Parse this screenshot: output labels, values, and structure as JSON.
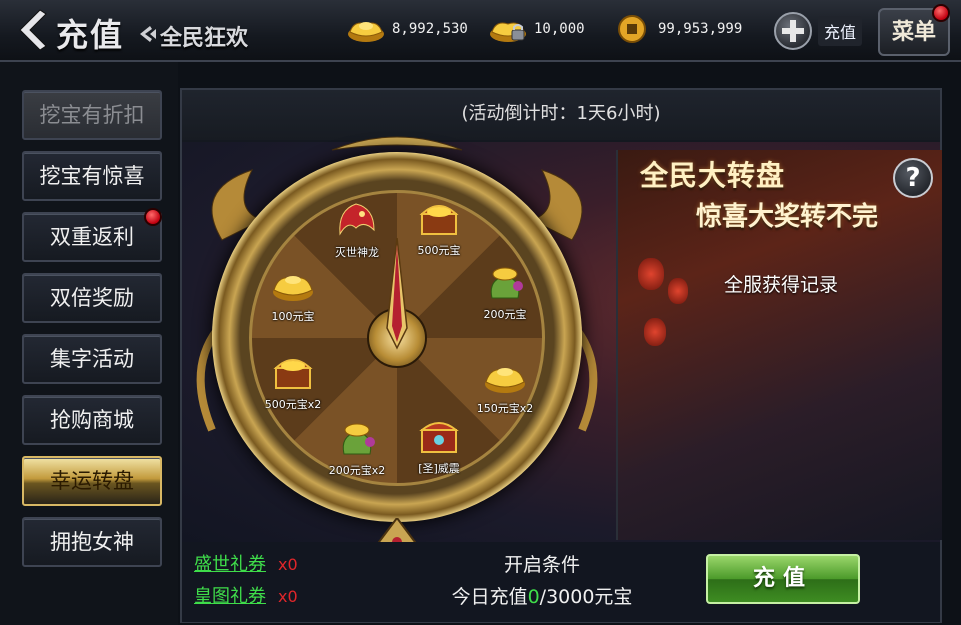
{
  "header": {
    "title": "充值",
    "subtitle": "全民狂欢",
    "back_icon": "back-arrow-icon",
    "currencies": [
      {
        "icon": "gold-ingot-icon",
        "value": "8,992,530"
      },
      {
        "icon": "locked-gold-ingot-icon",
        "value": "10,000"
      },
      {
        "icon": "copper-coin-icon",
        "value": "99,953,999"
      }
    ],
    "recharge_label": "充值",
    "menu_label": "菜单"
  },
  "sidebar": {
    "items": [
      {
        "label": "挖宝有折扣",
        "state": "disabled"
      },
      {
        "label": "挖宝有惊喜",
        "state": "normal"
      },
      {
        "label": "双重返利",
        "state": "normal",
        "badge": "red-dot"
      },
      {
        "label": "双倍奖励",
        "state": "normal"
      },
      {
        "label": "集字活动",
        "state": "normal"
      },
      {
        "label": "抢购商城",
        "state": "normal"
      },
      {
        "label": "幸运转盘",
        "state": "active"
      },
      {
        "label": "拥抱女神",
        "state": "normal"
      }
    ]
  },
  "main": {
    "countdown": "(活动倒计时：1天6小时)",
    "wheel": {
      "prizes": [
        {
          "label": "灭世神龙",
          "icon": "dragon-icon"
        },
        {
          "label": "500元宝",
          "icon": "treasure-chest-icon"
        },
        {
          "label": "200元宝",
          "icon": "ingot-bag-icon"
        },
        {
          "label": "150元宝x2",
          "icon": "gold-ingot-icon"
        },
        {
          "label": "[圣]威震",
          "icon": "treasure-chest-icon"
        },
        {
          "label": "200元宝x2",
          "icon": "ingot-bag-icon"
        },
        {
          "label": "500元宝x2",
          "icon": "treasure-chest-icon"
        },
        {
          "label": "100元宝",
          "icon": "gold-ingot-icon"
        }
      ]
    },
    "promo": {
      "title_line1": "全民大转盘",
      "title_line2": "惊喜大奖转不完",
      "help_label": "?",
      "record_link": "全服获得记录"
    },
    "vouchers": [
      {
        "name": "盛世礼券",
        "count": "x0"
      },
      {
        "name": "皇图礼券",
        "count": "x0"
      }
    ],
    "condition": {
      "title": "开启条件",
      "prefix": "今日充值",
      "current": "0",
      "suffix": "/3000元宝"
    },
    "recharge_button": "充值"
  },
  "colors": {
    "voucher_name": "#3fdc4a",
    "voucher_count": "#e0262a",
    "accent_gold": "#c9a552",
    "recharge_green": "#4b9a2a"
  }
}
